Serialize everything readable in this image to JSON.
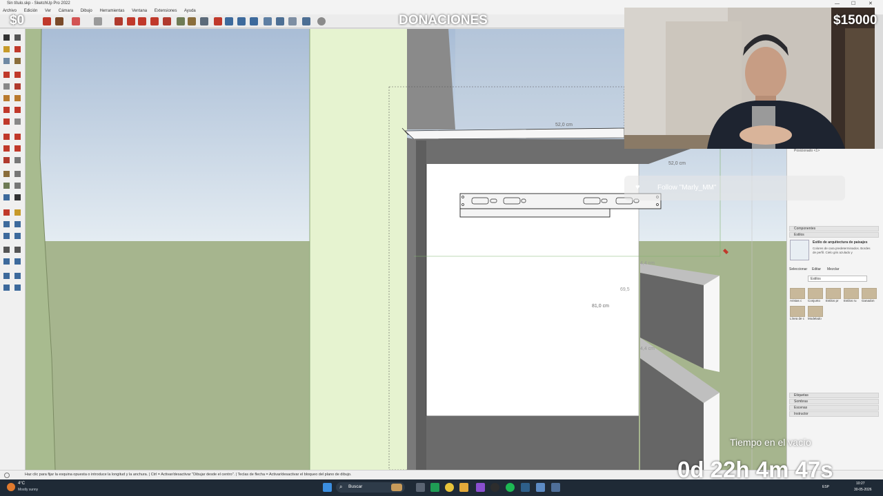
{
  "window": {
    "title": "Sin título.skp - SketchUp Pro 2022",
    "minimize_glyph": "—",
    "maximize_glyph": "☐",
    "close_glyph": "✕"
  },
  "menu": [
    "Archivo",
    "Edición",
    "Ver",
    "Cámara",
    "Dibujo",
    "Herramientas",
    "Ventana",
    "Extensiones",
    "Ayuda"
  ],
  "overlay": {
    "donation_left": "$0",
    "donation_title": "DONACIONES",
    "donation_goal": "$15000",
    "follow_text": "Follow \"Marly_MM\"",
    "live_time_label": "Tiempo en el vacío",
    "timer": "0d 22h 4m 47s"
  },
  "dimensions": {
    "width_top": "52,0 cm",
    "width_side": "52,0 cm",
    "height_main": "81,0 cm",
    "side_small_1": "69,5",
    "side_small_2": "4,4 cm",
    "side_small_3": "4,4 cm"
  },
  "tray": {
    "top_label": "Posicionado <1>",
    "components_label": "Componentes",
    "styles_label": "Estilos",
    "style_name": "Estilo de arquitectura de paisajes",
    "style_desc": "Colores de cara predeterminados. Bordes de perfil. Cielo gris azulado y",
    "tabs": [
      "Seleccionar",
      "Editar",
      "Mezclar"
    ],
    "dropdown": "Estilos",
    "style_items": [
      "Aristas c",
      "Conjunto",
      "Estilos pr",
      "Estilos ru",
      "Ganadon",
      "Línea de c",
      "Modelado"
    ],
    "bottom_panels": [
      "Etiquetas",
      "Sombras",
      "Escenas",
      "Instructor"
    ]
  },
  "statusbar": {
    "hint": "Haz clic para fijar la esquina opuesta o introduce la longitud y la anchura. | Ctrl = Activar/desactivar \"Dibujar desde el centro\". | Teclas de flecha = Activar/desactivar el bloqueo del plano de dibujo."
  },
  "taskbar": {
    "weather_temp": "4°C",
    "weather_desc": "Mostly sunny",
    "search_label": "Buscar",
    "lang": "ESP",
    "time": "10:27",
    "date": "30-05-2026"
  },
  "colors": {
    "sky_top": "#a9bdd6",
    "sky_bottom": "#e4ecf2",
    "ground": "#a6b58e",
    "panel_gray": "#747474",
    "cabinet_white": "#ffffff",
    "taskbar": "#1f2a36"
  }
}
